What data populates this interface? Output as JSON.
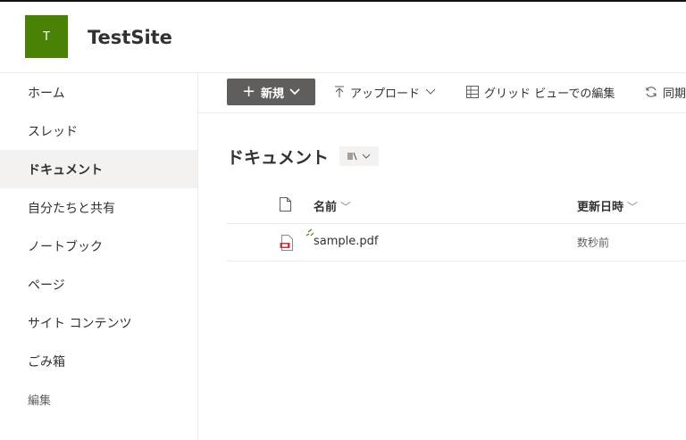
{
  "site": {
    "logo_letter": "T",
    "logo_color": "#498205",
    "title": "TestSite"
  },
  "nav": {
    "items": [
      {
        "label": "ホーム",
        "active": false
      },
      {
        "label": "スレッド",
        "active": false
      },
      {
        "label": "ドキュメント",
        "active": true
      },
      {
        "label": "自分たちと共有",
        "active": false
      },
      {
        "label": "ノートブック",
        "active": false
      },
      {
        "label": "ページ",
        "active": false
      },
      {
        "label": "サイト コンテンツ",
        "active": false
      },
      {
        "label": "ごみ箱",
        "active": false
      },
      {
        "label": "編集",
        "active": false
      }
    ]
  },
  "commands": {
    "new_label": "新規",
    "upload_label": "アップロード",
    "grid_label": "グリッド ビューでの編集",
    "sync_label": "同期"
  },
  "library": {
    "title": "ドキュメント",
    "view_icon": "library-view-icon"
  },
  "table": {
    "columns": {
      "name": "名前",
      "modified": "更新日時"
    },
    "rows": [
      {
        "name": "sample.pdf",
        "modified": "数秒前",
        "file_icon": "pdf-file-icon",
        "new_badge": true
      }
    ]
  },
  "colors": {
    "accent": "#498205",
    "new_button": "#605e5c",
    "nav_active_bg": "#f3f2f1",
    "pdf_red": "#d13438"
  }
}
